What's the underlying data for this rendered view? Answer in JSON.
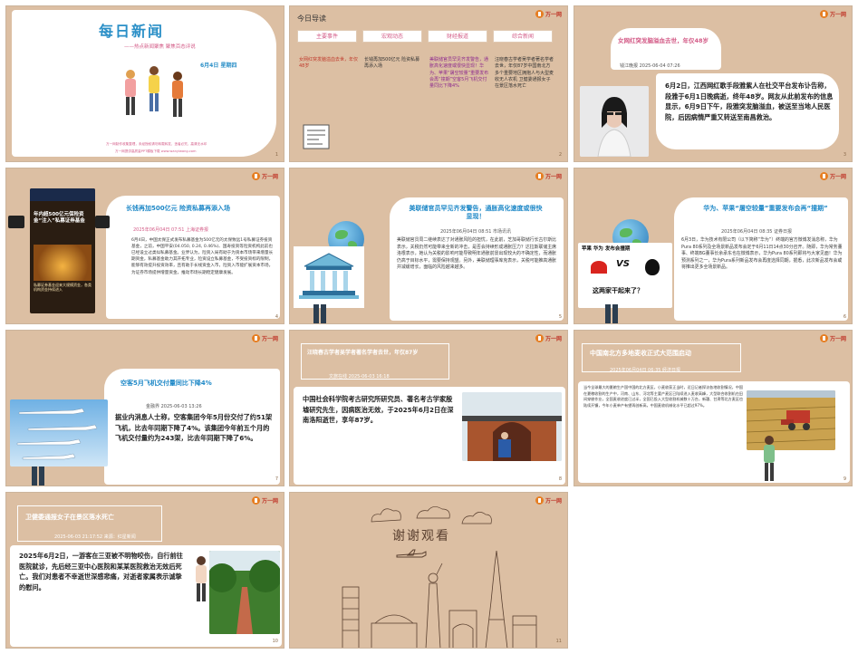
{
  "slides": [
    {
      "title": "每日新闻",
      "subtitle": "——热点新闻聚焦  聚焦百态评说",
      "date": "6月4日  星期四",
      "footer": "万一网制作收集整理，未经授权请勿转载转发，违者必究，高清无水印",
      "footer2": "万一网提供高质量PPT模板下载  www.wanyiwang.com",
      "num": "1"
    },
    {
      "title": "今日导读",
      "columns": [
        "主要事件",
        "宏观动态",
        "财经报道",
        "综合新闻"
      ],
      "items": [
        "女网红突发脑溢血去世，年仅48岁",
        "长钱再加500亿元 险资私募再添入场",
        "美联储官员罕见齐发警告，通胀高化速度或很快显现！华为、苹果“屠空较量”重要发布会再“撞期”空客5月飞机交付量同比下降4%",
        "汪晓春古学者吴学者著名学者去世，年仅87岁中国南北方多个重要地区拥抱人与大型麦收无人农机 卫健委通报女子在景区落水死亡"
      ],
      "num": "2"
    },
    {
      "heading": "女网红突发脑溢血去世，年仅48岁",
      "meta": "钱江晚报  2025-06-04  07:26",
      "body": "6月2日，江西网红歌手段雅紫人在社交平台发布讣告称，段雅于6月1日晚病逝，终年48岁。网友从此前发布的信息显示，6月9日下午，段雅突发脑溢血，被送至当地人民医院，后因病情严重又转送至南昌救治。",
      "num": "3"
    },
    {
      "side_title": "年内超500亿元保险资金“注入”私募证券基金",
      "side_sub": "私募证券基金迎来大规模资金，各类机构资金持续进入",
      "heading": "长钱再加500亿元 险资私募再添入场",
      "meta": "2025年06月04日  07:51  上海证券报",
      "body": "6月4日，中国太保正式发布私募基金为500亿元的太保致远1号私募证券投资基金，之前，中国平安(04.050, 0.24, 0.46%)、国寿投资等险资机构此前也已经设立过类似私募基金。业界认为，险资入局有助于为资本市场带来增量长期资金，私募基金助力其开拓专业，险资设立私募基金，不受投资标的限制，能够有效提升投资效率，且有助于长线资金入市，险资入市能扩展资本市场，为证券市场提供增量资金，推动市场长期稳定健康发展。",
      "num": "4"
    },
    {
      "heading": "美联储官员罕见齐发警告，通胀高化速度或很快显现！",
      "meta": "2025年06月04日  08:51  市场讯讯",
      "body": "美联储官员周二继续表达了对通胀风险的担忧，在此前，芝加哥联储行长古尔斯比表示，关税仍然可能带来全新的冲击，是否会持续形成通胀压力？达拉斯联储主席洛根表示，她认为关税的影响可能导致明年通胀前景出现较大的不确定性，而通胀仍高于目标水平，需要保持观望。另外，美联储理事库克表示，关税可能推高通胀并减缓增长，面临的风险越来越多。",
      "num": "5"
    },
    {
      "overlay_title": "苹果 华为  发布会撞期",
      "overlay_q": "这两家干起来了？",
      "heading": "华为、苹果“屠空较量”重要发布会再“撞期”",
      "meta": "2025年06月04日  08:35  证券日报",
      "body": "6月3日，华为技术有限公司（以下简称“华为”）终端的官方微博发消息称，华为Pura 80系列及全场景新品发布会定于6月11日14点30分召开。随即，华为常务董事、终端BG董事长余承东也在微博表示，华为Pura 80系列即将与大家见面！华为预测系列之一，华为Pura系列新品发布会再度选择同期，据悉，此次新品发布会或将推出更多全场景新品。",
      "num": "6"
    },
    {
      "heading": "空客5月飞机交付量同比下降4%",
      "meta": "金融界  2025-06-03  13:26",
      "body": "据业内消息人士称，空客集团今年5月份交付了约51架飞机，比去年同期下降了4%。该集团今年前五个月的飞机交付量约为243架，比去年同期下降了6%。",
      "num": "7"
    },
    {
      "heading": "汪晓春古学者吴学者著名学者去世，年仅87岁",
      "meta": "文旅在线  2025-06-03  16:18",
      "body": "中国社会科学院考古研究所研究员、著名考古学家殷墟研究先生，因病医治无效，于2025年6月2日在深南洛阳逝世，享年87岁。",
      "num": "8"
    },
    {
      "heading": "中国南北方多地麦收正式大范围启动",
      "meta": "2025年06月04日  06:35  经济日报",
      "body": "当今全球最大的夏粮生产国中国的北方麦区，小麦收获正当时，近日记者探访各地收割情况，中国在夏粮收割的生产中，河南、山东、河北等主要产麦区已陆续进入麦收高峰，大型联合收割机在田间穿梭作业，全国麦收进度已过半，全国已投入大型收割机械数十万台，新疆、甘肃等北方麦区也陆续开镰，今年小麦单产有望再创新高，中国麦收机械化水平已超过97%。",
      "num": "9"
    },
    {
      "heading": "卫健委通报女子在景区落水死亡",
      "meta": "2025-06-03  21:17:52  来源：红星新闻",
      "body": "2025年6月2日，一游客在三亚被不明物咬伤，自行前往医院就诊，先后经三亚中心医院和某某医院救治无效后死亡。我们对患者不幸逝世深感悲痛，对逝者家属表示诚挚的慰问。",
      "num": "10"
    },
    {
      "thanks": "谢谢观看",
      "num": "11"
    }
  ],
  "brand": {
    "logo_text": "万一网",
    "accent": "#1e88c7",
    "bg": "#dcbfa3"
  }
}
